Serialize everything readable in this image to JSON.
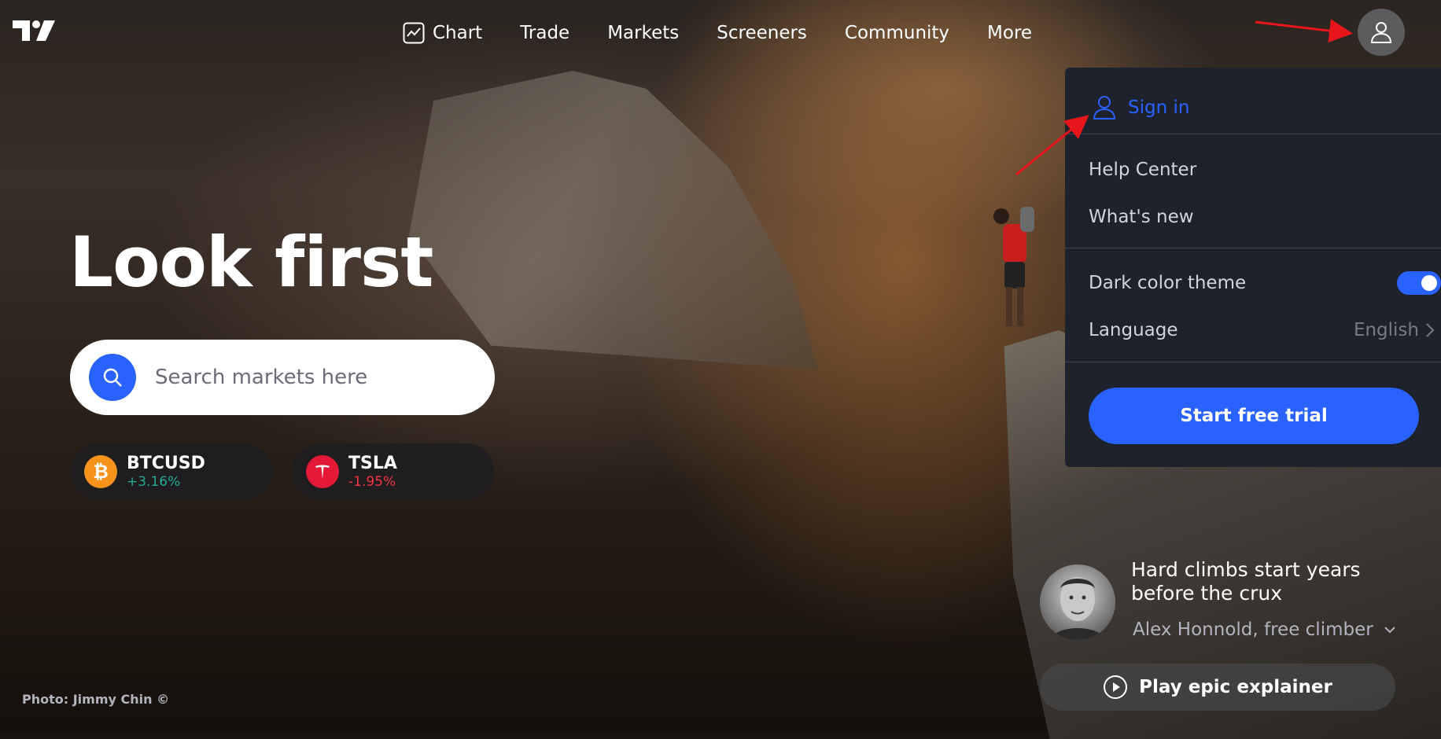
{
  "nav": {
    "items": [
      {
        "label": "Chart",
        "icon": "chart-icon"
      },
      {
        "label": "Trade"
      },
      {
        "label": "Markets"
      },
      {
        "label": "Screeners"
      },
      {
        "label": "Community"
      },
      {
        "label": "More"
      }
    ]
  },
  "hero": {
    "title": "Look first",
    "search_placeholder": "Search markets here"
  },
  "tickers": [
    {
      "symbol": "BTCUSD",
      "change": "+3.16%",
      "icon": "bitcoin-icon",
      "color": "#f7931a"
    },
    {
      "symbol": "TSLA",
      "change": "-1.95%",
      "icon": "tesla-icon",
      "color": "#e31937"
    }
  ],
  "menu": {
    "sign_in": "Sign in",
    "help_center": "Help Center",
    "whats_new": "What's new",
    "dark_theme": "Dark color theme",
    "dark_theme_on": true,
    "language_label": "Language",
    "language_value": "English",
    "trial_button": "Start free trial"
  },
  "quote": {
    "text": "Hard climbs start years before the crux",
    "author": "Alex Honnold, free climber",
    "play_button": "Play epic explainer"
  },
  "photo_credit": "Photo: Jimmy Chin ©",
  "colors": {
    "accent": "#2962ff",
    "menu_bg": "#1e222d",
    "up": "#22ab94",
    "down": "#f23645"
  }
}
